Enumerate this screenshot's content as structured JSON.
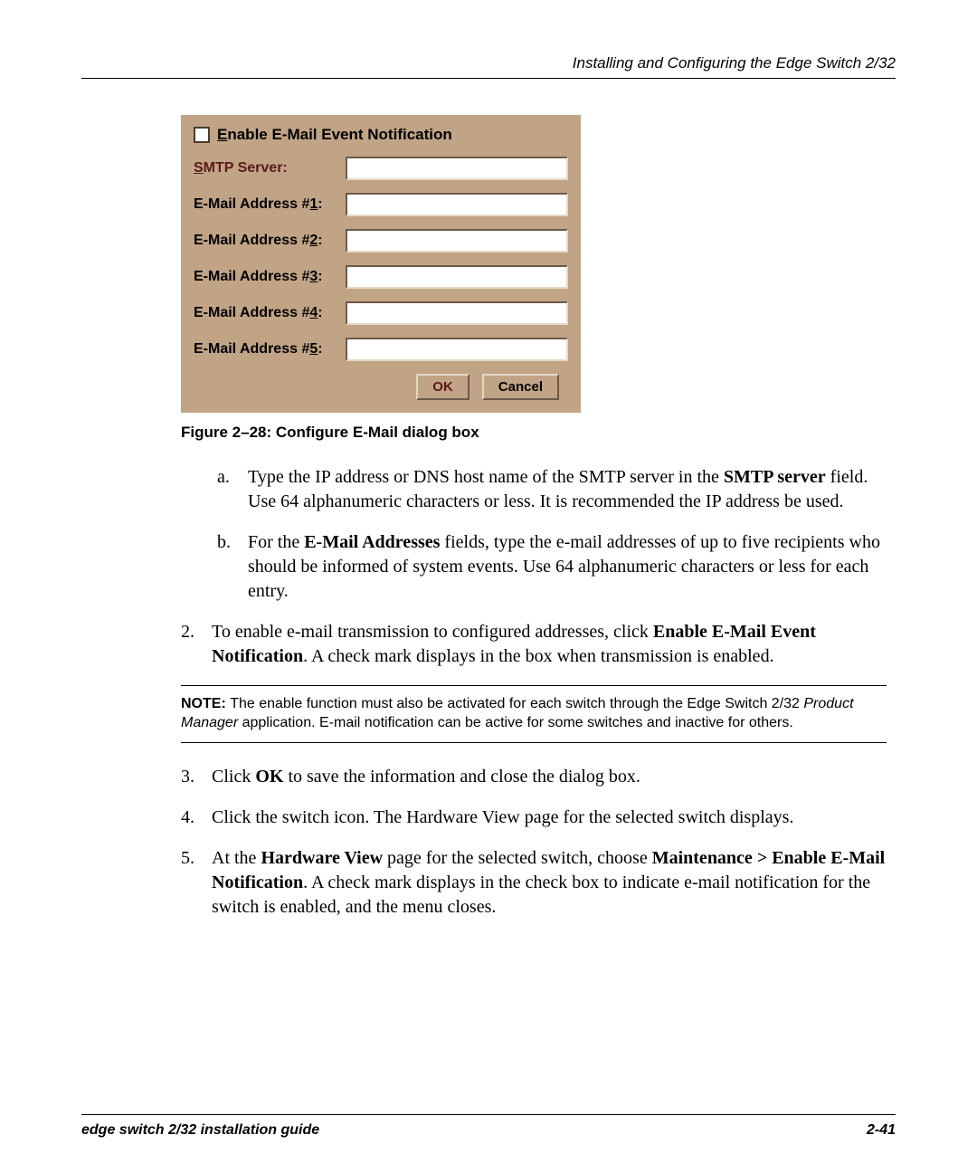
{
  "header": {
    "title": "Installing and Configuring the Edge Switch 2/32"
  },
  "dialog": {
    "enable_checkbox_label": "Enable E-Mail Event Notification",
    "enable_underline_char": "E",
    "smtp_label": "SMTP Server:",
    "smtp_underline_char": "S",
    "smtp_value": "",
    "addr1_label": "E-Mail Address #1:",
    "addr1_value": "",
    "addr2_label": "E-Mail Address #2:",
    "addr2_value": "",
    "addr3_label": "E-Mail Address #3:",
    "addr3_value": "",
    "addr4_label": "E-Mail Address #4:",
    "addr4_value": "",
    "addr5_label": "E-Mail Address #5:",
    "addr5_value": "",
    "ok_label": "OK",
    "cancel_label": "Cancel"
  },
  "caption": "Figure 2–28:  Configure E-Mail dialog box",
  "step_a_marker": "a.",
  "step_a_pre": "Type the IP address or DNS host name of the SMTP server in the ",
  "step_a_bold": "SMTP server",
  "step_a_post": " field. Use 64 alphanumeric characters or less. It is recommended the IP address be used.",
  "step_b_marker": "b.",
  "step_b_pre": "For the ",
  "step_b_bold": "E-Mail Addresses",
  "step_b_post": " fields, type the e-mail addresses of up to five recipients who should be informed of system events. Use 64 alphanumeric characters or less for each entry.",
  "step_2_marker": "2.",
  "step_2_pre": "To enable e-mail transmission to configured addresses, click ",
  "step_2_bold": "Enable E-Mail Event Notification",
  "step_2_post": ". A check mark displays in the box when transmission is enabled.",
  "note_label": "NOTE:  ",
  "note_pre": "The enable function must also be activated for each switch through the Edge Switch 2/32 ",
  "note_ital": "Product Manager",
  "note_post": " application. E-mail notification can be active for some switches and inactive for others.",
  "step_3_marker": "3.",
  "step_3_pre": "Click ",
  "step_3_bold": "OK",
  "step_3_post": " to save the information and close the dialog box.",
  "step_4_marker": "4.",
  "step_4_text": "Click the switch icon. The Hardware View page for the selected switch displays.",
  "step_5_marker": "5.",
  "step_5_pre": "At the ",
  "step_5_bold1": "Hardware View",
  "step_5_mid1": " page for the selected switch, choose ",
  "step_5_bold2": "Maintenance > Enable E-Mail Notification",
  "step_5_post": ". A check mark displays in the check box to indicate e-mail notification for the switch is enabled, and the menu closes.",
  "footer": {
    "left": "edge switch 2/32 installation guide",
    "right": "2-41"
  }
}
